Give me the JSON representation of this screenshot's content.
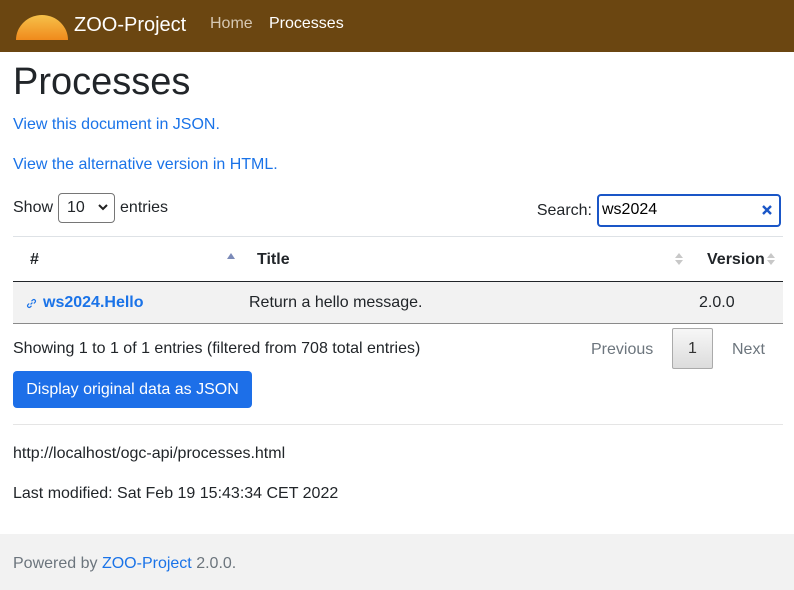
{
  "navbar": {
    "brand": "ZOO-Project",
    "links": [
      {
        "label": "Home"
      },
      {
        "label": "Processes"
      }
    ]
  },
  "page": {
    "title": "Processes",
    "json_link": "View this document in JSON.",
    "html_link": "View the alternative version in HTML."
  },
  "controls": {
    "show_label": "Show",
    "entries_value": "10",
    "entries_label": "entries",
    "search_label": "Search:",
    "search_value": "ws2024"
  },
  "table": {
    "columns": [
      "#",
      "Title",
      "Version"
    ],
    "rows": [
      {
        "id": "ws2024.Hello",
        "title": "Return a hello message.",
        "version": "2.0.0"
      }
    ]
  },
  "pagination": {
    "info": "Showing 1 to 1 of 1 entries (filtered from 708 total entries)",
    "previous": "Previous",
    "current_page": "1",
    "next": "Next"
  },
  "actions": {
    "json_button": "Display original data as JSON"
  },
  "meta": {
    "url": "http://localhost/ogc-api/processes.html",
    "last_modified": "Last modified: Sat Feb 19 15:43:34 CET 2022"
  },
  "footer": {
    "prefix": "Powered by",
    "link": "ZOO-Project",
    "suffix": "2.0.0."
  },
  "colors": {
    "navbar_bg": "#6b4611",
    "link": "#1a73e8",
    "button_bg": "#1d6fe8"
  }
}
